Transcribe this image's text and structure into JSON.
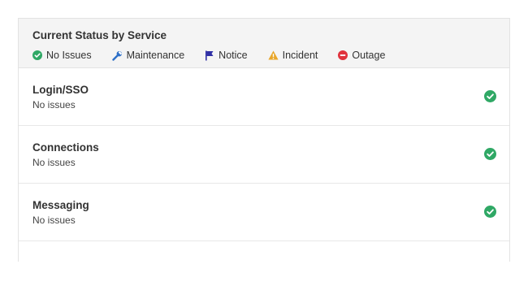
{
  "header": {
    "title": "Current Status by Service",
    "legend": [
      {
        "label": "No Issues",
        "icon": "check-circle-icon",
        "color": "#2fa865"
      },
      {
        "label": "Maintenance",
        "icon": "wrench-icon",
        "color": "#2d6fc7"
      },
      {
        "label": "Notice",
        "icon": "flag-icon",
        "color": "#2f2fa5"
      },
      {
        "label": "Incident",
        "icon": "warning-icon",
        "color": "#e8a629"
      },
      {
        "label": "Outage",
        "icon": "minus-circle-icon",
        "color": "#e0323c"
      }
    ]
  },
  "services": [
    {
      "name": "Login/SSO",
      "status": "No issues",
      "icon": "check-circle-icon"
    },
    {
      "name": "Connections",
      "status": "No issues",
      "icon": "check-circle-icon"
    },
    {
      "name": "Messaging",
      "status": "No issues",
      "icon": "check-circle-icon"
    }
  ],
  "colors": {
    "ok": "#2fa865",
    "header_bg": "#f4f4f4",
    "border": "#e3e3e3"
  }
}
